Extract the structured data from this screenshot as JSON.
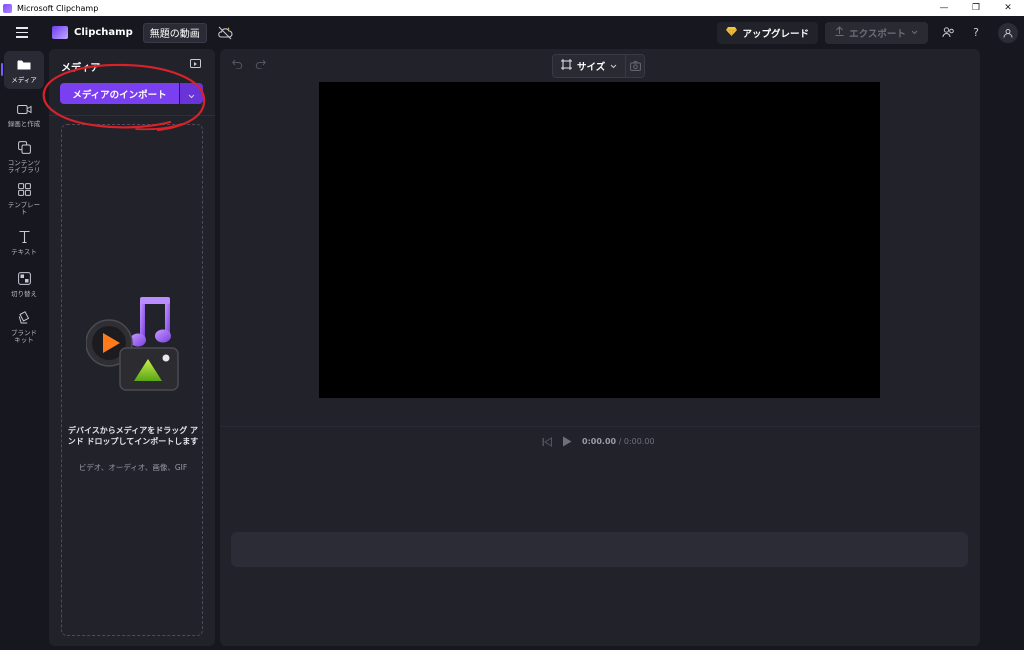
{
  "window": {
    "title": "Microsoft Clipchamp",
    "controls": [
      "—",
      "❐",
      "✕"
    ]
  },
  "header": {
    "brand": "Clipchamp",
    "project_title": "無題の動画",
    "upgrade_label": "アップグレード",
    "export_label": "エクスポート",
    "help_label": "?"
  },
  "rail": {
    "items": [
      {
        "label": "メディア",
        "icon": "folder-icon",
        "active": true
      },
      {
        "label": "録画と作成",
        "icon": "camera-icon"
      },
      {
        "label": "コンテンツ\nライブラリ",
        "icon": "library-icon"
      },
      {
        "label": "テンプレー\nト",
        "icon": "templates-icon"
      },
      {
        "label": "テキスト",
        "icon": "text-icon"
      },
      {
        "label": "切り替え",
        "icon": "transitions-icon"
      },
      {
        "label": "ブランド\nキット",
        "icon": "brand-kit-icon"
      }
    ]
  },
  "media_panel": {
    "title": "メディア",
    "import_label": "メディアのインポート",
    "drop_main": "デバイスからメディアをドラッグ アンド ドロップしてインポートします",
    "drop_sub": "ビデオ、オーディオ、画像、GIF"
  },
  "preview": {
    "size_label": "サイズ",
    "current_time": "0:00.00",
    "total_time": "/ 0:00.00"
  },
  "colors": {
    "accent": "#7b3ff2",
    "annotation": "#d8222a",
    "background": "#17171f",
    "panel": "#22222b"
  }
}
